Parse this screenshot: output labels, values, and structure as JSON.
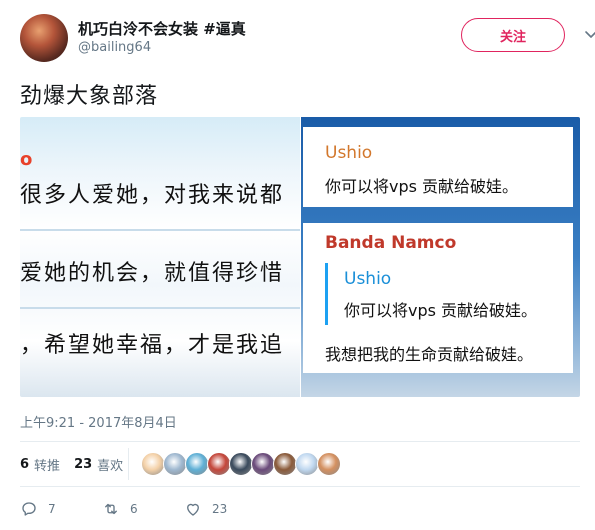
{
  "tweet": {
    "display_name": "机巧白泠不会女装 #逼真",
    "handle": "@bailing64",
    "follow_label": "关注",
    "text": "劲爆大象部落",
    "timestamp": "上午9:21 - 2017年8月4日"
  },
  "media": {
    "left": {
      "fragment": "o",
      "lines": [
        "很多人爱她，对我来说都",
        "爱她的机会，就值得珍惜",
        "，希望她幸福，才是我追"
      ]
    },
    "right": {
      "card1": {
        "name": "Ushio",
        "message": "你可以将vps 贡献给破娃。"
      },
      "card2": {
        "name": "Banda Namco",
        "quote_name": "Ushio",
        "quote_message": "你可以将vps 贡献给破娃。",
        "message": "我想把我的生命贡献给破娃。"
      }
    }
  },
  "stats": {
    "retweets_count": "6",
    "retweets_label": "转推",
    "likes_count": "23",
    "likes_label": "喜欢"
  },
  "likers": [
    {
      "name": "liker-1",
      "color": "#f4d1a8"
    },
    {
      "name": "liker-2",
      "color": "#9fb8d0"
    },
    {
      "name": "liker-3",
      "color": "#5fb0d6"
    },
    {
      "name": "liker-4",
      "color": "#c4463a"
    },
    {
      "name": "liker-5",
      "color": "#3a4a5c"
    },
    {
      "name": "liker-6",
      "color": "#6a4a7a"
    },
    {
      "name": "liker-7",
      "color": "#8a5a3a"
    },
    {
      "name": "liker-8",
      "color": "#c0d8f0"
    },
    {
      "name": "liker-9",
      "color": "#d49060"
    }
  ],
  "actions": {
    "reply_count": "7",
    "retweet_count": "6",
    "like_count": "23"
  },
  "colors": {
    "follow_accent": "#e0245e",
    "secondary_text": "#657786",
    "ushio_name": "#d2772c",
    "banda_name": "#c0392b",
    "quote_bar": "#1da1f2"
  }
}
